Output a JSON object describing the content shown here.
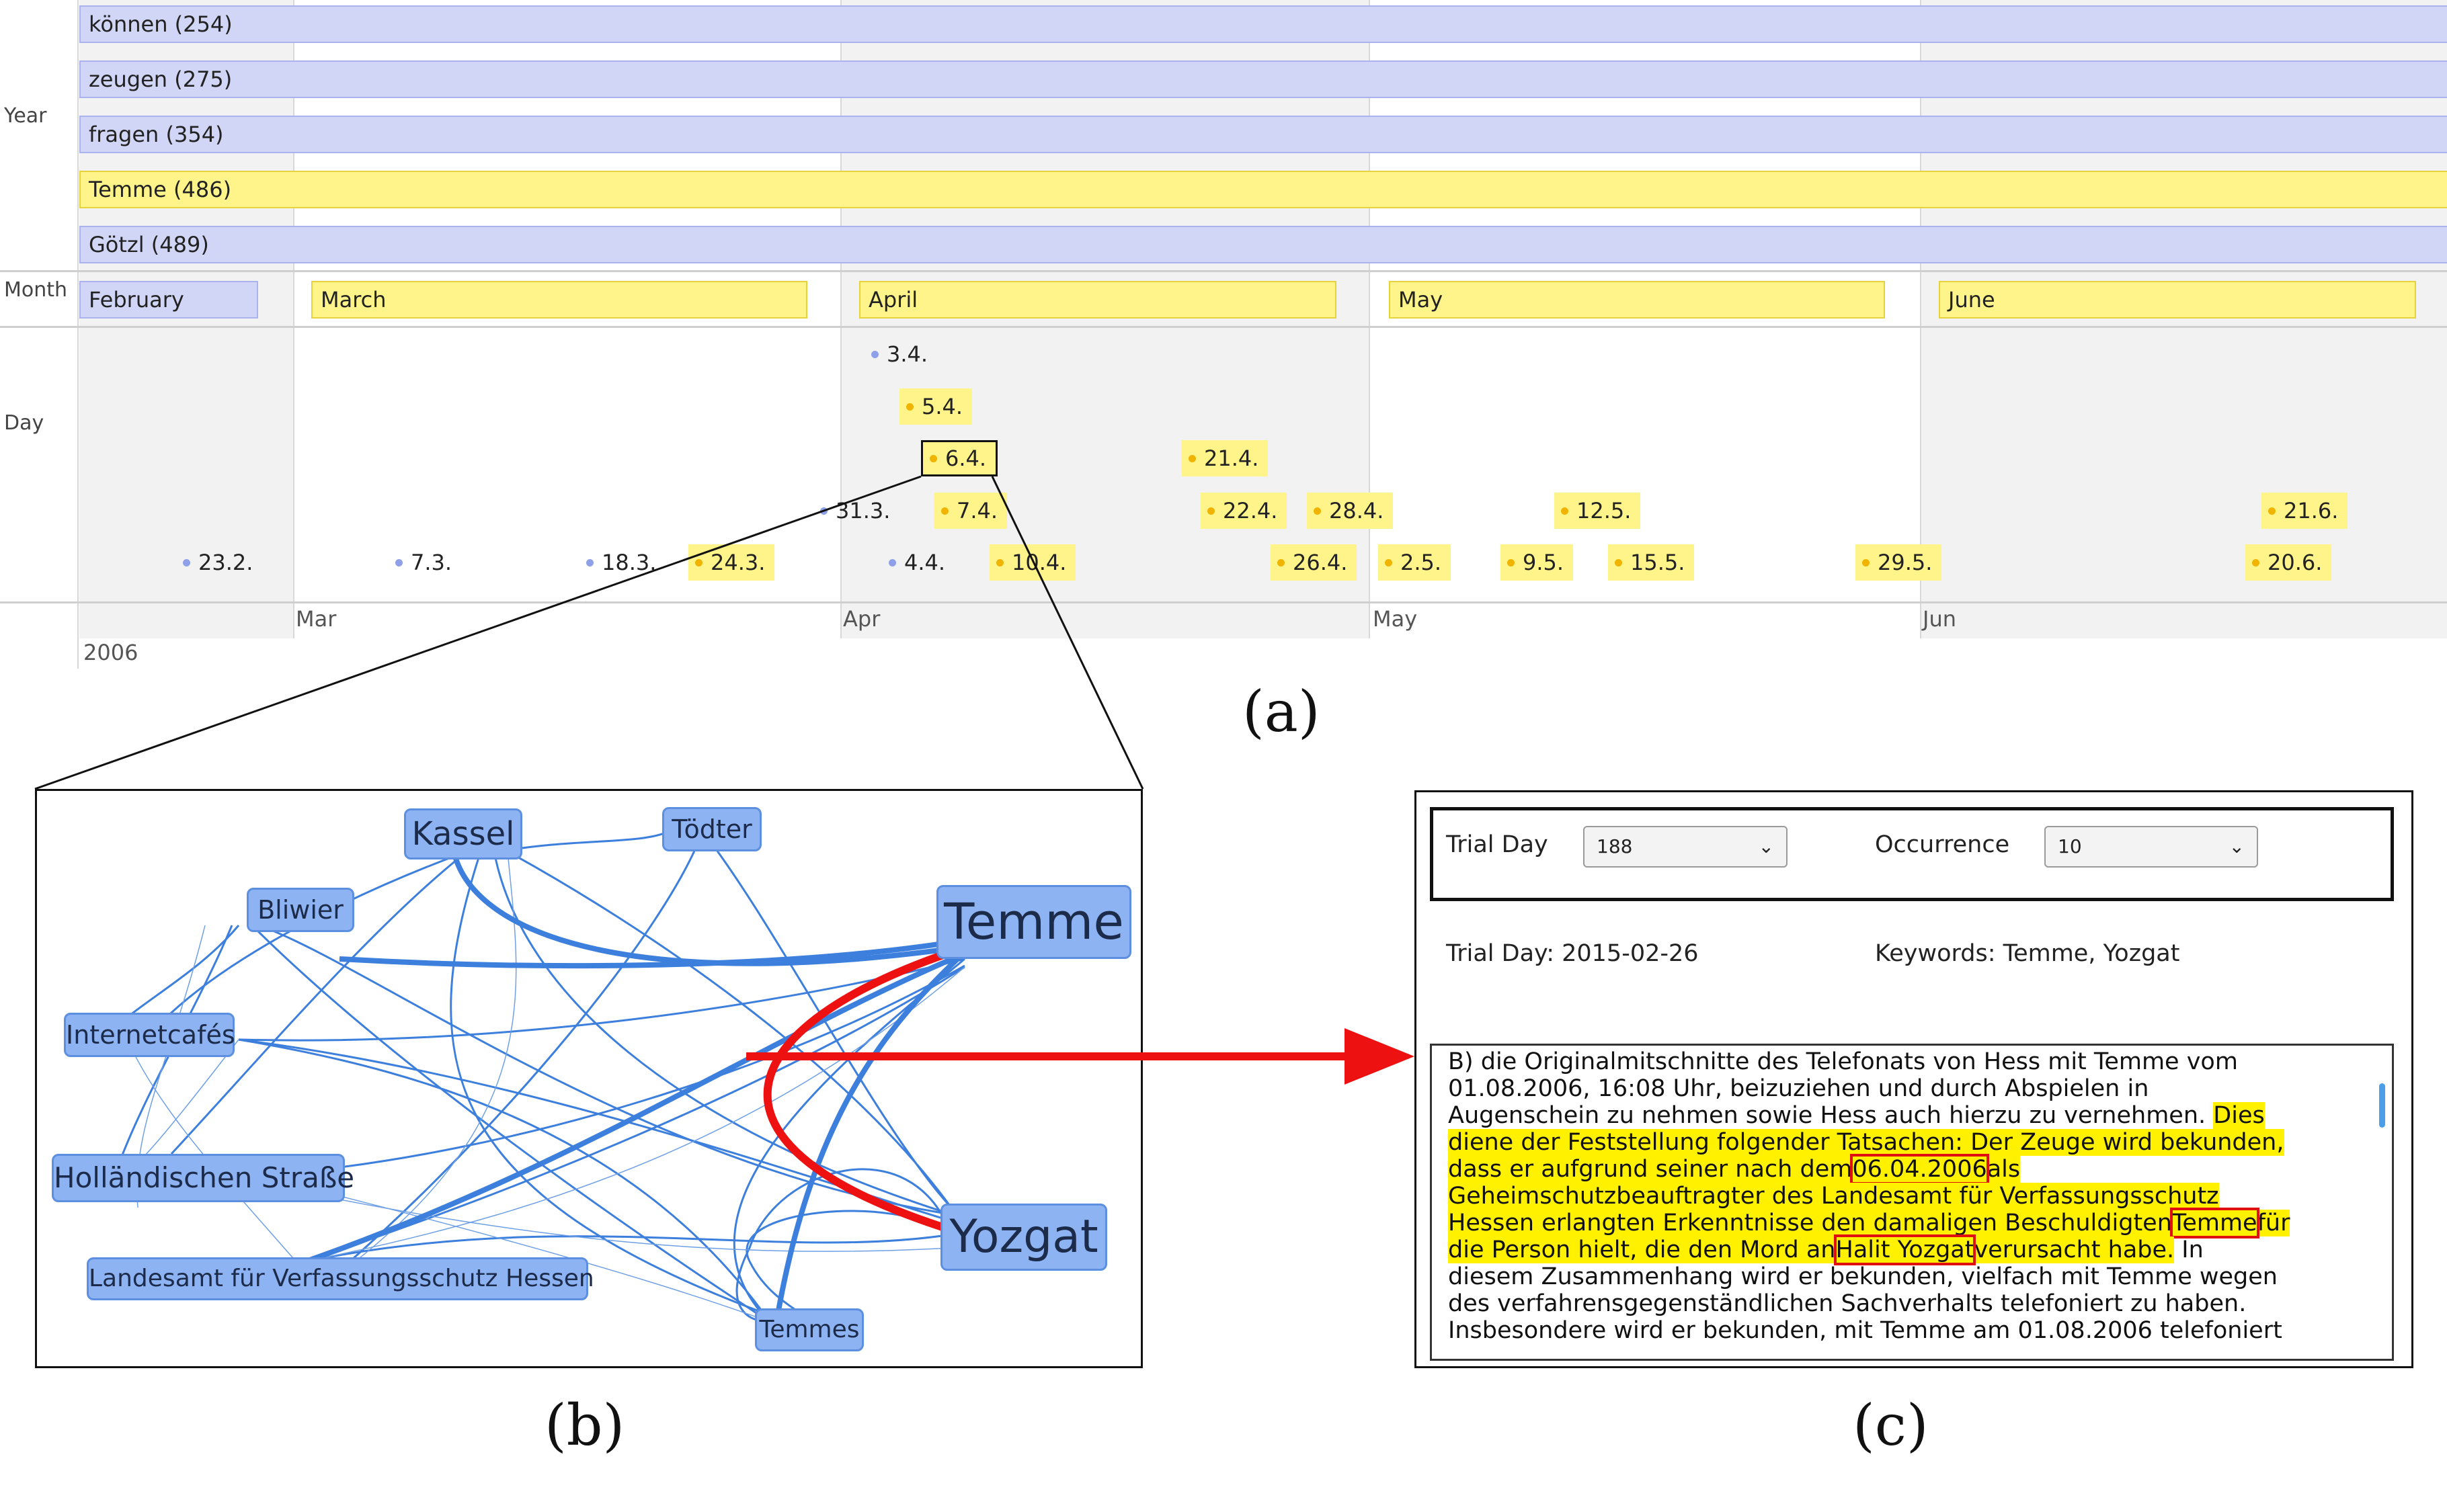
{
  "timeline": {
    "row_labels": {
      "year": "Year",
      "month": "Month",
      "day": "Day"
    },
    "year_bars": [
      {
        "label": "können (254)",
        "highlighted": false
      },
      {
        "label": "zeugen (275)",
        "highlighted": false
      },
      {
        "label": "fragen (354)",
        "highlighted": false
      },
      {
        "label": "Temme (486)",
        "highlighted": true
      },
      {
        "label": "Götzl (489)",
        "highlighted": false
      }
    ],
    "months": [
      {
        "label": "February",
        "highlighted": false
      },
      {
        "label": "March",
        "highlighted": true
      },
      {
        "label": "April",
        "highlighted": true
      },
      {
        "label": "May",
        "highlighted": true
      },
      {
        "label": "June",
        "highlighted": true
      }
    ],
    "days": [
      {
        "label": "3.4.",
        "highlighted": false
      },
      {
        "label": "5.4.",
        "highlighted": true
      },
      {
        "label": "6.4.",
        "highlighted": true,
        "selected": true
      },
      {
        "label": "21.4.",
        "highlighted": true
      },
      {
        "label": "31.3.",
        "highlighted": false
      },
      {
        "label": "7.4.",
        "highlighted": true
      },
      {
        "label": "22.4.",
        "highlighted": true
      },
      {
        "label": "28.4.",
        "highlighted": true
      },
      {
        "label": "12.5.",
        "highlighted": true
      },
      {
        "label": "21.6.",
        "highlighted": true
      },
      {
        "label": "23.2.",
        "highlighted": false
      },
      {
        "label": "7.3.",
        "highlighted": false
      },
      {
        "label": "18.3.",
        "highlighted": false
      },
      {
        "label": "24.3.",
        "highlighted": true
      },
      {
        "label": "4.4.",
        "highlighted": false
      },
      {
        "label": "10.4.",
        "highlighted": true
      },
      {
        "label": "26.4.",
        "highlighted": true
      },
      {
        "label": "2.5.",
        "highlighted": true
      },
      {
        "label": "9.5.",
        "highlighted": true
      },
      {
        "label": "15.5.",
        "highlighted": true
      },
      {
        "label": "29.5.",
        "highlighted": true
      },
      {
        "label": "20.6.",
        "highlighted": true
      }
    ],
    "axis_months": [
      "Mar",
      "Apr",
      "May",
      "Jun"
    ],
    "axis_year": "2006"
  },
  "captions": {
    "a": "(a)",
    "b": "(b)",
    "c": "(c)"
  },
  "network": {
    "nodes": [
      "Kassel",
      "Tödter",
      "Bliwier",
      "Temme",
      "Internetcafés",
      "Holländischen Straße",
      "Yozgat",
      "Landesamt für Verfassungsschutz Hessen",
      "Temmes"
    ],
    "highlighted_edge": "Temme–Yozgat",
    "colors": {
      "edge": "#3d7fdc",
      "highlight_edge": "#ee1111",
      "node_fill": "#8db3f2"
    }
  },
  "document": {
    "trial_day_label": "Trial Day",
    "trial_day_value": "188",
    "occurrence_label": "Occurrence",
    "occurrence_value": "10",
    "trial_date": "Trial Day: 2015-02-26",
    "keywords": "Keywords: Temme, Yozgat",
    "lines": [
      "B) die Originalmitschnitte des Telefonats von Hess mit Temme vom",
      "01.08.2006, 16:08 Uhr, beizuziehen und durch Abspielen in",
      "Augenschein zu nehmen sowie Hess auch hierzu zu vernehmen.",
      "Dies",
      "diene der Feststellung folgender Tatsachen: Der Zeuge wird bekunden,",
      "dass er aufgrund seiner nach dem",
      "06.04.2006",
      "als",
      "Geheimschutzbeauftragter des Landesamt für Verfassungsschutz",
      "Hessen erlangten Erkenntnisse den damaligen Beschuldigten",
      "Temme",
      "für",
      "die Person hielt, die den Mord an",
      "Halit Yozgat",
      "verursacht habe.",
      "In",
      "diesem Zusammenhang wird er bekunden, vielfach mit Temme wegen",
      "des verfahrensgegenständlichen Sachverhalts telefoniert zu haben.",
      "Insbesondere wird er bekunden, mit Temme am 01.08.2006 telefoniert"
    ]
  }
}
